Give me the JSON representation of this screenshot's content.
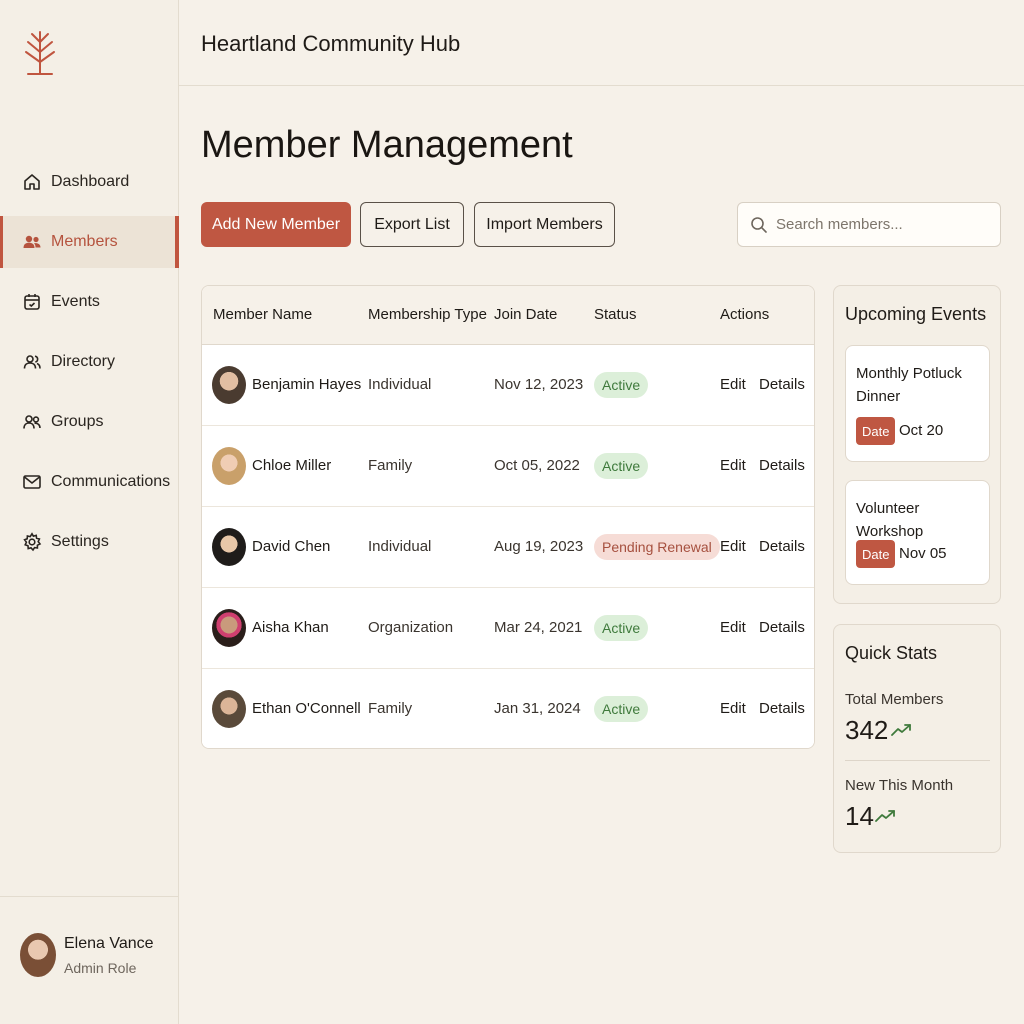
{
  "app": {
    "title": "Heartland Community Hub"
  },
  "sidebar": {
    "items": [
      {
        "label": "Dashboard",
        "icon": "home-icon"
      },
      {
        "label": "Members",
        "icon": "users-icon",
        "active": true
      },
      {
        "label": "Events",
        "icon": "calendar-icon"
      },
      {
        "label": "Directory",
        "icon": "contacts-icon"
      },
      {
        "label": "Groups",
        "icon": "group-icon"
      },
      {
        "label": "Communications",
        "icon": "mail-icon"
      },
      {
        "label": "Settings",
        "icon": "gear-icon"
      }
    ],
    "user": {
      "name": "Elena Vance",
      "role": "Admin Role"
    }
  },
  "page": {
    "title": "Member Management"
  },
  "toolbar": {
    "add_label": "Add New Member",
    "export_label": "Export List",
    "import_label": "Import Members",
    "search_placeholder": "Search members..."
  },
  "table": {
    "columns": [
      "Member Name",
      "Membership Type",
      "Join Date",
      "Status",
      "Actions"
    ],
    "edit_label": "Edit",
    "details_label": "Details",
    "rows": [
      {
        "name": "Benjamin Hayes",
        "type": "Individual",
        "join_date": "Nov 12, 2023",
        "status": "Active"
      },
      {
        "name": "Chloe Miller",
        "type": "Family",
        "join_date": "Oct 05, 2022",
        "status": "Active"
      },
      {
        "name": "David Chen",
        "type": "Individual",
        "join_date": "Aug 19, 2023",
        "status": "Pending Renewal"
      },
      {
        "name": "Aisha Khan",
        "type": "Organization",
        "join_date": "Mar 24, 2021",
        "status": "Active"
      },
      {
        "name": "Ethan O'Connell",
        "type": "Family",
        "join_date": "Jan 31, 2024",
        "status": "Active"
      }
    ]
  },
  "events": {
    "title": "Upcoming Events",
    "items": [
      {
        "title": "Monthly Potluck Dinner",
        "tag": "Date",
        "date": "Oct 20"
      },
      {
        "title": "Volunteer Workshop",
        "tag": "Date",
        "date": "Nov 05"
      }
    ]
  },
  "stats": {
    "title": "Quick Stats",
    "total_label": "Total Members",
    "total_value": "342",
    "new_label": "New This Month",
    "new_value": "14"
  },
  "colors": {
    "accent": "#bf5742",
    "active_bg": "#dcefd9",
    "active_text": "#3f7a3c",
    "pending_bg": "#f6dcd6",
    "pending_text": "#a6503f",
    "trend": "#3f7a3c"
  }
}
